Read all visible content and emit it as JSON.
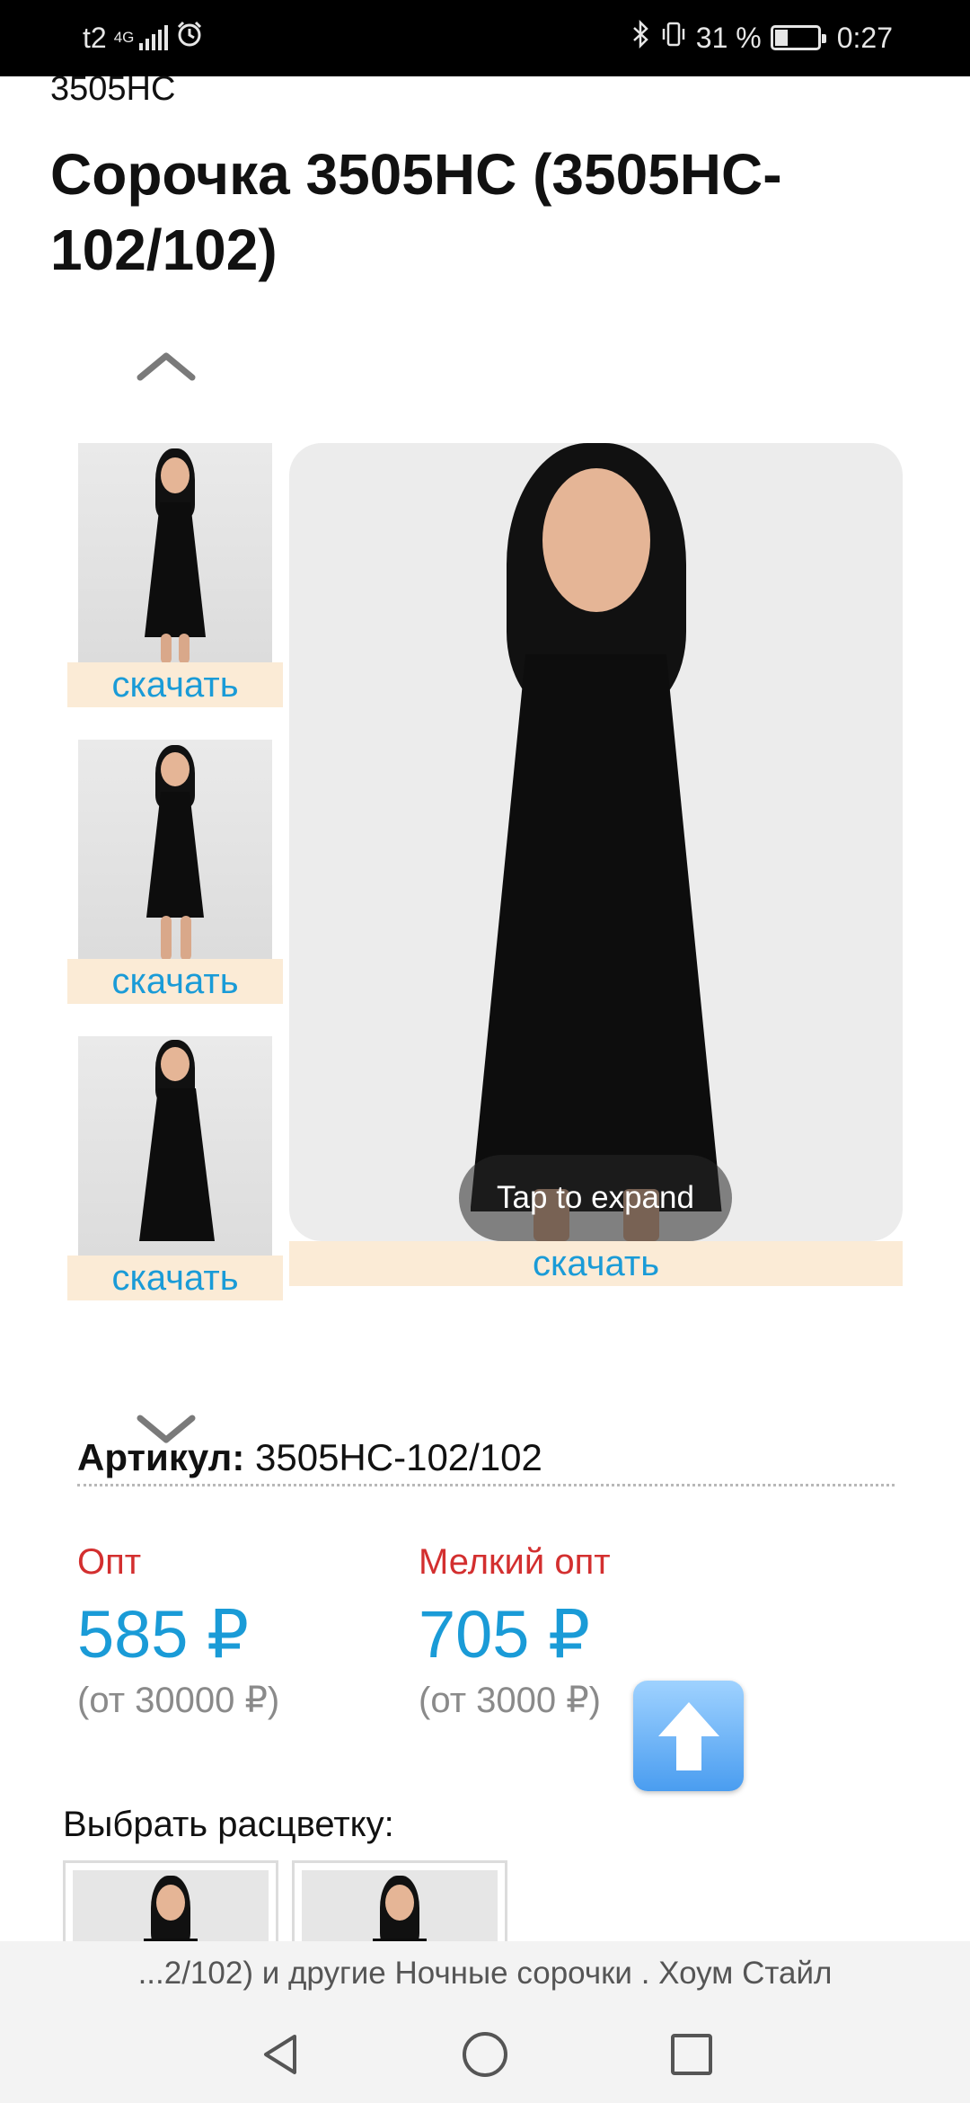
{
  "status_bar": {
    "carrier": "t2",
    "network_type": "4G",
    "battery_percent": "31 %",
    "time": "0:27",
    "icons": [
      "signal-icon",
      "alarm-icon",
      "bluetooth-icon",
      "vibrate-icon",
      "battery-icon"
    ]
  },
  "product": {
    "breadcrumb": "3505HC",
    "title": "Сорочка 3505HC (3505HC-102/102)",
    "download_label": "скачать",
    "tap_to_expand": "Tap to expand",
    "article_label": "Артикул:",
    "article_value": "3505HC-102/102"
  },
  "prices": [
    {
      "label": "Опт",
      "value": "585 ₽",
      "from": "(от 30000 ₽)"
    },
    {
      "label": "Мелкий опт",
      "value": "705 ₽",
      "from": "(от 3000 ₽)"
    }
  ],
  "color_section": {
    "label": "Выбрать расцветку:"
  },
  "bottom_tab_title": "...2/102) и другие Ночные сорочки . Хоум Стайл",
  "colors": {
    "accent_blue": "#1a9bd7",
    "label_red": "#d32f2f",
    "download_bg": "#fbebd6"
  }
}
